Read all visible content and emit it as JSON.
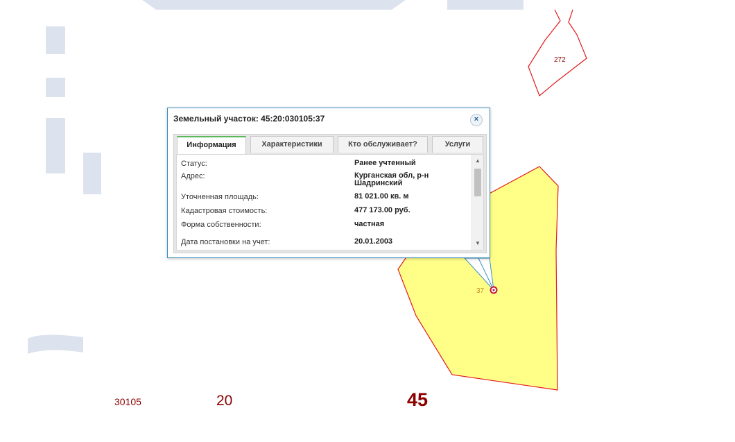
{
  "map": {
    "labels": {
      "block": "30105",
      "district": "20",
      "region": "45",
      "parcel_272": "272",
      "parcel_37": "37"
    },
    "colors": {
      "parcel_fill": "#ffff88",
      "parcel_border": "#e31a1c",
      "label_color": "#8b0000",
      "watermark": "#dde3ee",
      "popup_border": "#3c8ebf",
      "active_tab_accent": "#5cb85c"
    }
  },
  "popup": {
    "title": "Земельный участок: 45:20:030105:37",
    "close_icon": "×",
    "tabs": [
      {
        "label": "Информация",
        "active": true
      },
      {
        "label": "Характеристики",
        "active": false
      },
      {
        "label": "Кто обслуживает?",
        "active": false
      },
      {
        "label": "Услуги",
        "active": false
      }
    ],
    "rows": [
      {
        "key": "Статус:",
        "value": "Ранее учтенный"
      },
      {
        "key": "Адрес:",
        "value": "Курганская обл, р-н Шадринский"
      },
      {
        "key": "Уточненная площадь:",
        "value": "81 021.00 кв. м"
      },
      {
        "key": "Кадастровая стоимость:",
        "value": "477 173.00 руб."
      },
      {
        "key": "Форма собственности:",
        "value": "частная"
      },
      {
        "key": "Дата постановки на учет:",
        "value": "20.01.2003"
      }
    ],
    "scroll": {
      "up_icon": "▲",
      "down_icon": "▼"
    }
  }
}
